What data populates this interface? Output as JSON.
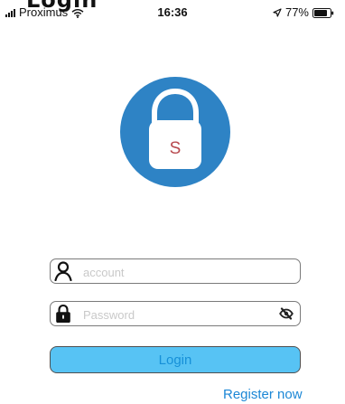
{
  "top_cut_text": "Login",
  "status_bar": {
    "carrier": "Proximus",
    "time": "16:36",
    "battery": "77%"
  },
  "logo": {
    "letter": "S",
    "accent": "#2f85c8",
    "circle": "#2e83c5",
    "lock_body": "#ffffff",
    "letter_color": "#b84a4f"
  },
  "account": {
    "placeholder": "account"
  },
  "password": {
    "placeholder": "Password"
  },
  "login_button": {
    "label": "Login",
    "fill": "#57c3f4"
  },
  "register_link": {
    "label": "Register now"
  },
  "icons": {
    "status_signal": "signal-icon",
    "status_wifi": "wifi-icon",
    "status_location": "location-arrow-icon",
    "status_battery": "battery-icon",
    "account": "user-icon",
    "password": "lock-icon",
    "visibility": "eye-slash-icon",
    "logo": "padlock-icon"
  }
}
